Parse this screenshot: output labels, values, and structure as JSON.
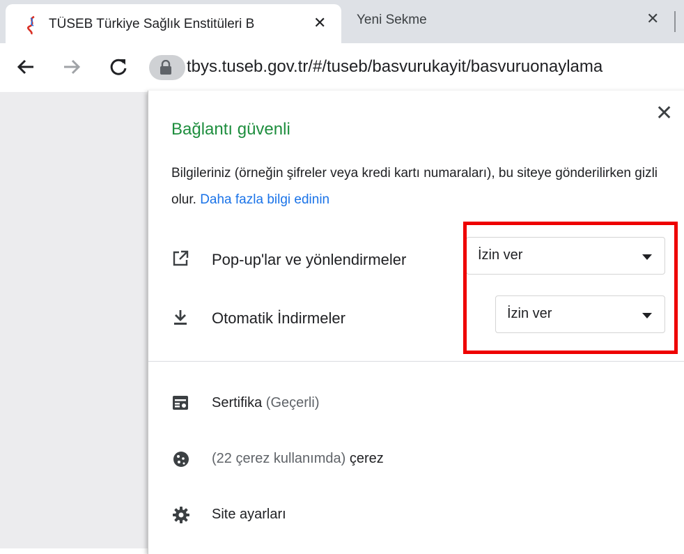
{
  "tabs": [
    {
      "title": "TÜSEB Türkiye Sağlık Enstitüleri B",
      "active": true
    },
    {
      "title": "Yeni Sekme",
      "active": false
    }
  ],
  "tab_close_glyph": "✕",
  "toolbar": {
    "url": "tbys.tuseb.gov.tr/#/tuseb/basvurukayit/basvuruonaylama"
  },
  "site_info": {
    "title": "Bağlantı güvenli",
    "description": "Bilgileriniz (örneğin şifreler veya kredi kartı numaraları), bu siteye gönderilirken gizli olur. ",
    "learn_more": "Daha fazla bilgi edinin",
    "close_glyph": "✕",
    "permissions": [
      {
        "label": "Pop-up'lar ve yönlendirmeler",
        "value": "İzin ver",
        "icon": "external-link-icon"
      },
      {
        "label": "Otomatik İndirmeler",
        "value": "İzin ver",
        "icon": "download-icon"
      }
    ],
    "certificate": {
      "label": "Sertifika",
      "status": " (Geçerli)"
    },
    "cookies": {
      "count_text": "(22 çerez kullanımda)",
      "label": " çerez"
    },
    "site_settings": "Site ayarları"
  },
  "colors": {
    "secure_green": "#1e8e3e",
    "link_blue": "#1a73e8",
    "highlight_red": "#ee0000",
    "tabstrip": "#dee1e6"
  }
}
